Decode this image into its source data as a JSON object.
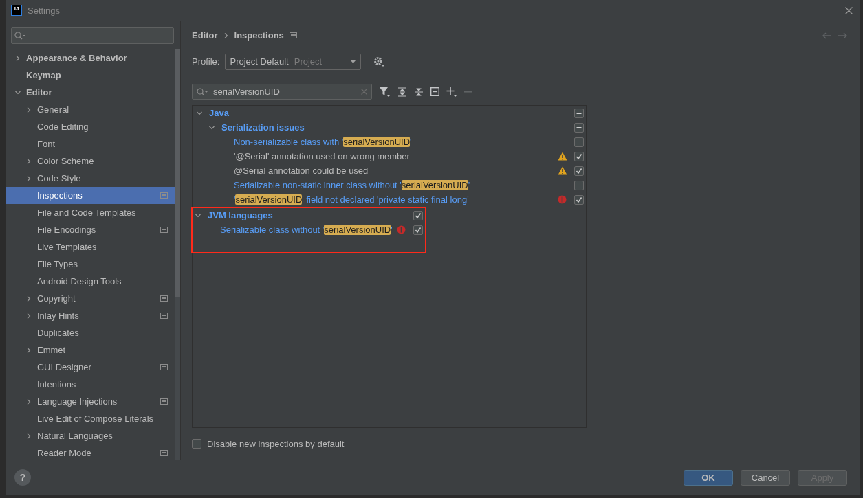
{
  "window": {
    "title": "Settings",
    "logo": "IJ"
  },
  "sidebar": {
    "items": [
      {
        "label": "Appearance & Behavior",
        "bold": true,
        "expanded": false,
        "selected": false
      },
      {
        "label": "Keymap",
        "bold": true,
        "selected": false
      },
      {
        "label": "Editor",
        "bold": true,
        "expanded": true,
        "selected": false,
        "children": [
          {
            "label": "General",
            "expanded": false,
            "selected": false
          },
          {
            "label": "Code Editing",
            "selected": false
          },
          {
            "label": "Font",
            "selected": false
          },
          {
            "label": "Color Scheme",
            "expanded": false,
            "selected": false
          },
          {
            "label": "Code Style",
            "expanded": false,
            "selected": false
          },
          {
            "label": "Inspections",
            "selected": true,
            "project_scope": true
          },
          {
            "label": "File and Code Templates",
            "selected": false
          },
          {
            "label": "File Encodings",
            "selected": false,
            "project_scope": true
          },
          {
            "label": "Live Templates",
            "selected": false
          },
          {
            "label": "File Types",
            "selected": false
          },
          {
            "label": "Android Design Tools",
            "selected": false
          },
          {
            "label": "Copyright",
            "expanded": false,
            "selected": false,
            "project_scope": true
          },
          {
            "label": "Inlay Hints",
            "expanded": false,
            "selected": false,
            "project_scope": true
          },
          {
            "label": "Duplicates",
            "selected": false
          },
          {
            "label": "Emmet",
            "expanded": false,
            "selected": false
          },
          {
            "label": "GUI Designer",
            "selected": false,
            "project_scope": true
          },
          {
            "label": "Intentions",
            "selected": false
          },
          {
            "label": "Language Injections",
            "expanded": false,
            "selected": false,
            "project_scope": true
          },
          {
            "label": "Live Edit of Compose Literals",
            "selected": false
          },
          {
            "label": "Natural Languages",
            "expanded": false,
            "selected": false
          },
          {
            "label": "Reader Mode",
            "selected": false,
            "project_scope": true
          }
        ]
      }
    ]
  },
  "breadcrumb": [
    "Editor",
    "Inspections"
  ],
  "profile": {
    "label": "Profile:",
    "value": "Project Default",
    "scope": "Project"
  },
  "filter": {
    "value": "serialVersionUID"
  },
  "tree": [
    {
      "label": "Java",
      "expanded": true,
      "partial": true,
      "highlighted": false,
      "children": [
        {
          "label": "Serialization issues",
          "expanded": true,
          "partial": true,
          "children": [
            {
              "parts": [
                {
                  "text": "Non-serializable class with "
                },
                {
                  "text": "'"
                },
                {
                  "text": "serialVersionUID",
                  "match": true
                },
                {
                  "text": "'"
                }
              ],
              "modified": true,
              "kind": "plain",
              "checked": false
            },
            {
              "parts": [
                {
                  "text": "'@Serial' annotation used on wrong member"
                }
              ],
              "modified": false,
              "kind": "warning",
              "checked": true
            },
            {
              "parts": [
                {
                  "text": "@Serial annotation could be used"
                }
              ],
              "modified": false,
              "kind": "warning",
              "checked": true
            },
            {
              "parts": [
                {
                  "text": "Serializable non-static inner class without "
                },
                {
                  "text": "'"
                },
                {
                  "text": "serialVersionUID",
                  "match": true
                },
                {
                  "text": "'"
                }
              ],
              "modified": true,
              "kind": "plain",
              "checked": false
            },
            {
              "parts": [
                {
                  "text": "'"
                },
                {
                  "text": "serialVersionUID",
                  "match": true
                },
                {
                  "text": "' field not declared 'private static final long'"
                }
              ],
              "modified": true,
              "kind": "error",
              "checked": true
            }
          ]
        }
      ]
    },
    {
      "label": "JVM languages",
      "expanded": true,
      "checked": true,
      "highlighted": true,
      "children": [
        {
          "parts": [
            {
              "text": "Serializable class without "
            },
            {
              "text": "'"
            },
            {
              "text": "serialVersionUID",
              "match": true
            },
            {
              "text": "'"
            }
          ],
          "modified": true,
          "kind": "error",
          "checked": true
        }
      ]
    }
  ],
  "disable_new": {
    "label": "Disable new inspections by default",
    "checked": false
  },
  "buttons": [
    {
      "label": "OK",
      "kind": "primary",
      "disabled": false
    },
    {
      "label": "Cancel",
      "kind": "normal",
      "disabled": false
    },
    {
      "label": "Apply",
      "kind": "normal",
      "disabled": true
    }
  ],
  "help": {
    "label": "?"
  }
}
